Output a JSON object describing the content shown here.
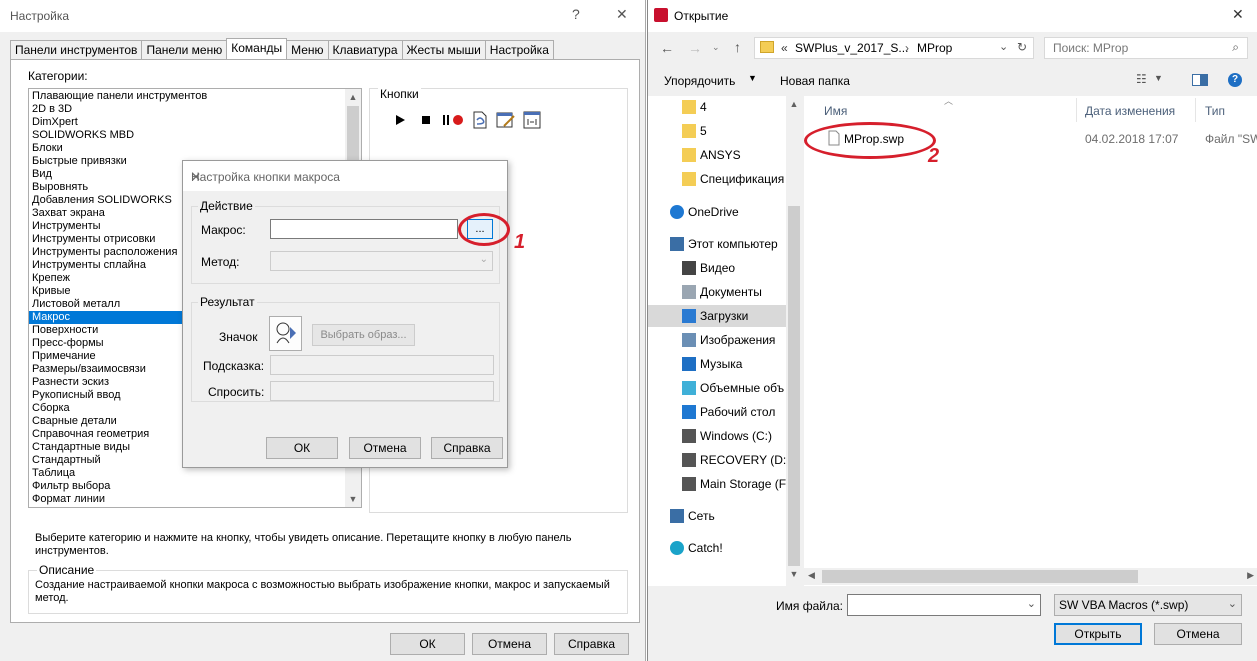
{
  "settings_window": {
    "title": "Настройка",
    "help_glyph": "?",
    "close_glyph": "✕",
    "tabs": [
      "Панели инструментов",
      "Панели меню",
      "Команды",
      "Меню",
      "Клавиатура",
      "Жесты мыши",
      "Настройка"
    ],
    "active_tab": "Команды",
    "categories_label": "Категории:",
    "categories": [
      "Плавающие панели инструментов",
      "2D в 3D",
      "DimXpert",
      "SOLIDWORKS MBD",
      "Блоки",
      "Быстрые привязки",
      "Вид",
      "Выровнять",
      "Добавления SOLIDWORKS",
      "Захват экрана",
      "Инструменты",
      "Инструменты отрисовки",
      "Инструменты расположения",
      "Инструменты сплайна",
      "Крепеж",
      "Кривые",
      "Листовой металл",
      "Макрос",
      "Поверхности",
      "Пресс-формы",
      "Примечание",
      "Размеры/взаимосвязи",
      "Разнести эскиз",
      "Рукописный ввод",
      "Сборка",
      "Сварные детали",
      "Справочная геометрия",
      "Стандартные виды",
      "Стандартный",
      "Таблица",
      "Фильтр выбора",
      "Формат линии"
    ],
    "selected_category": "Макрос",
    "buttons_label": "Кнопки",
    "instruction": "Выберите категорию и нажмите на кнопку, чтобы увидеть описание. Перетащите кнопку в любую панель инструментов.",
    "description_label": "Описание",
    "description": "Создание настраиваемой кнопки макроса с возможностью выбрать изображение кнопки, макрос и запускаемый метод.",
    "ok": "ОК",
    "cancel": "Отмена",
    "help": "Справка"
  },
  "macro_dialog": {
    "title": "Настройка кнопки макроса",
    "close_glyph": "✕",
    "action_label": "Действие",
    "macro_label": "Макрос:",
    "macro_value": "",
    "browse": "...",
    "method_label": "Метод:",
    "method_value": "",
    "result_label": "Результат",
    "icon_label": "Значок",
    "choose_image": "Выбрать образ...",
    "tooltip_label": "Подсказка:",
    "tooltip_value": "",
    "prompt_label": "Спросить:",
    "prompt_value": "",
    "ok": "ОК",
    "cancel": "Отмена",
    "help": "Справка"
  },
  "annotations": {
    "first": "1",
    "second": "2",
    "color": "#d61f2c"
  },
  "open_dialog": {
    "title": "Открытие",
    "close_glyph": "✕",
    "breadcrumb": [
      "«",
      "SWPlus_v_2017_S...",
      "›",
      "MProp"
    ],
    "search_placeholder": "Поиск: MProp",
    "organize": "Упорядочить",
    "new_folder": "Новая папка",
    "nav_items": [
      "4",
      "5",
      "ANSYS",
      "Спецификация",
      "OneDrive",
      "Этот компьютер",
      "Видео",
      "Документы",
      "Загрузки",
      "Изображения",
      "Музыка",
      "Объемные объ",
      "Рабочий стол",
      "Windows (C:)",
      "RECOVERY (D:)",
      "Main Storage (F:",
      "Сеть",
      "Catch!"
    ],
    "selected_nav": "Загрузки",
    "columns": [
      "Имя",
      "Дата изменения",
      "Тип"
    ],
    "files": [
      {
        "name": "MProp.swp",
        "modified": "04.02.2018 17:07",
        "type": "Файл \"SW"
      }
    ],
    "filename_label": "Имя файла:",
    "filename_value": "",
    "filter": "SW VBA Macros (*.swp)",
    "open": "Открыть",
    "cancel": "Отмена"
  }
}
